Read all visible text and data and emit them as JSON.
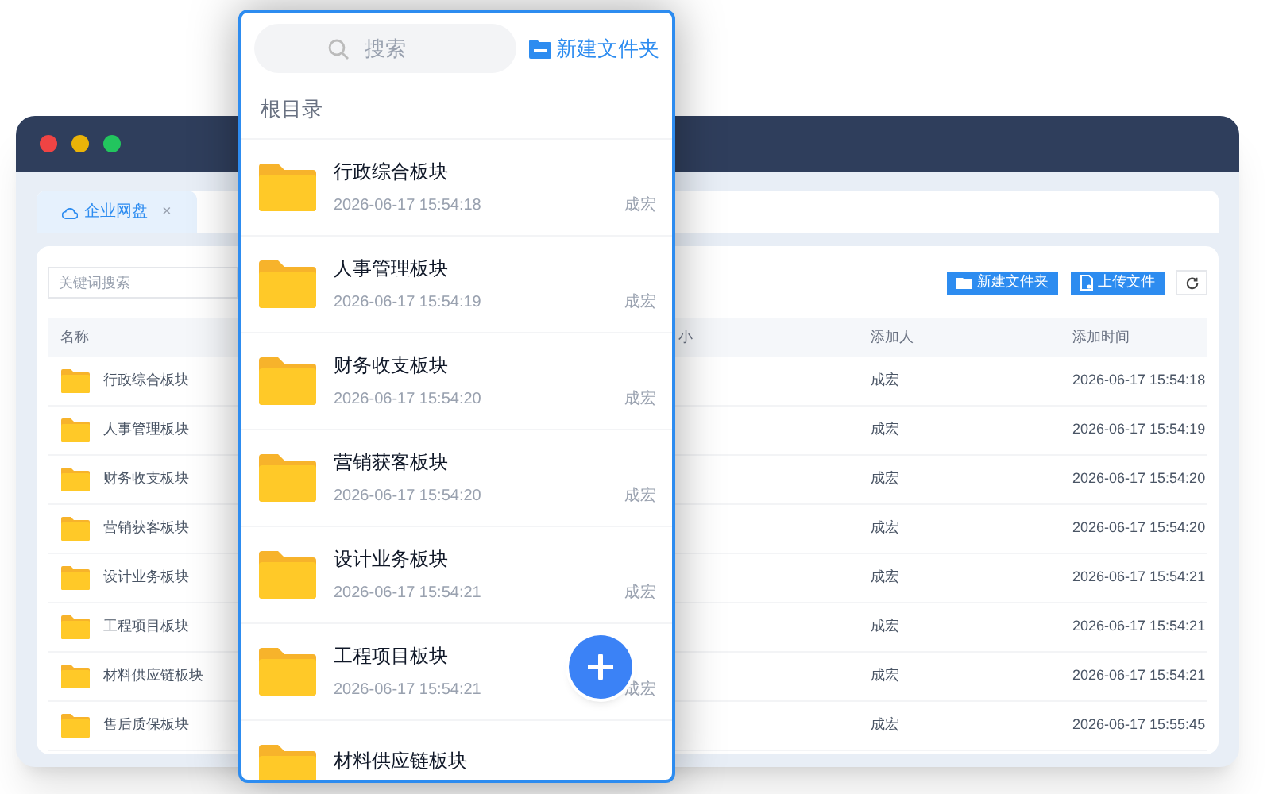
{
  "window": {
    "tab": {
      "label": "企业网盘",
      "close": "×",
      "selected": true
    },
    "search": {
      "placeholder": "关键词搜索"
    },
    "buttons": [
      {
        "label": "新建文件夹",
        "kind": "folder"
      },
      {
        "label": "上传文件",
        "kind": "upload"
      }
    ],
    "table": {
      "columns": [
        "名称",
        "小",
        "添加人",
        "添加时间"
      ],
      "rows": [
        {
          "name": "行政综合板块",
          "author": "成宏",
          "time": "2026-06-17 15:54:18"
        },
        {
          "name": "人事管理板块",
          "author": "成宏",
          "time": "2026-06-17 15:54:19"
        },
        {
          "name": "财务收支板块",
          "author": "成宏",
          "time": "2026-06-17 15:54:20"
        },
        {
          "name": "营销获客板块",
          "author": "成宏",
          "time": "2026-06-17 15:54:20"
        },
        {
          "name": "设计业务板块",
          "author": "成宏",
          "time": "2026-06-17 15:54:21"
        },
        {
          "name": "工程项目板块",
          "author": "成宏",
          "time": "2026-06-17 15:54:21"
        },
        {
          "name": "材料供应链板块",
          "author": "成宏",
          "time": "2026-06-17 15:54:21"
        },
        {
          "name": "售后质保板块",
          "author": "成宏",
          "time": "2026-06-17 15:55:45"
        }
      ]
    }
  },
  "mobile": {
    "search": {
      "placeholder": "搜索"
    },
    "new_folder": "新建文件夹",
    "breadcrumb": "根目录",
    "items": [
      {
        "title": "行政综合板块",
        "date": "2026-06-17 15:54:18",
        "author": "成宏"
      },
      {
        "title": "人事管理板块",
        "date": "2026-06-17 15:54:19",
        "author": "成宏"
      },
      {
        "title": "财务收支板块",
        "date": "2026-06-17 15:54:20",
        "author": "成宏"
      },
      {
        "title": "营销获客板块",
        "date": "2026-06-17 15:54:20",
        "author": "成宏"
      },
      {
        "title": "设计业务板块",
        "date": "2026-06-17 15:54:21",
        "author": "成宏"
      },
      {
        "title": "工程项目板块",
        "date": "2026-06-17 15:54:21",
        "author": "成宏"
      },
      {
        "title": "材料供应链板块"
      }
    ]
  }
}
